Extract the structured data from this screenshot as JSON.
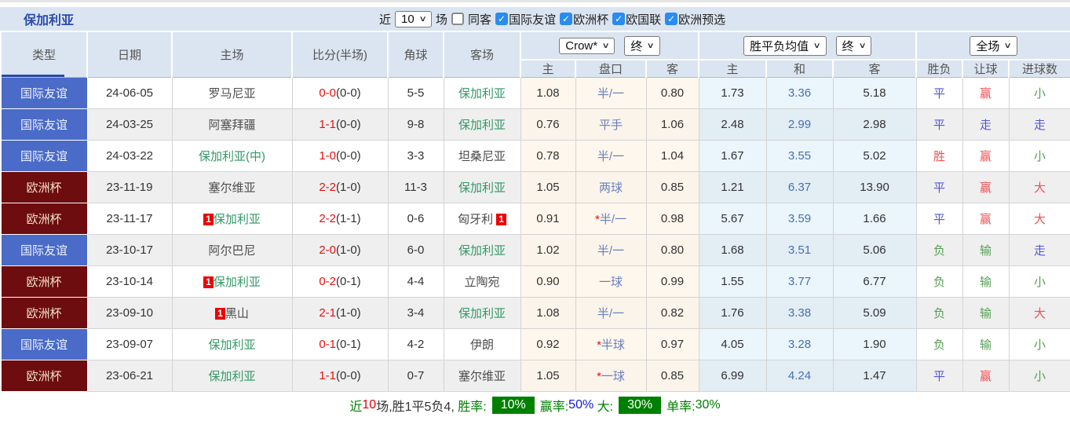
{
  "topbar": {
    "title": "保加利亚",
    "near_label": "近",
    "count_select": "10",
    "count_suffix": "场",
    "same_away": {
      "label": "同客",
      "state": "unchecked"
    },
    "filters": [
      {
        "label": "国际友谊",
        "state": "checked"
      },
      {
        "label": "欧洲杯",
        "state": "checked"
      },
      {
        "label": "欧国联",
        "state": "checked"
      },
      {
        "label": "欧洲预选",
        "state": "checked"
      }
    ]
  },
  "header": {
    "type": "类型",
    "date": "日期",
    "home": "主场",
    "score": "比分(半场)",
    "corner": "角球",
    "away": "客场",
    "odds_select": "Crow*",
    "odds_state_select": "终",
    "odds_sub": {
      "home": "主",
      "handicap": "盘口",
      "away": "客"
    },
    "wdl_select": "胜平负均值",
    "wdl_state_select": "终",
    "wdl_sub": {
      "home": "主",
      "draw": "和",
      "away": "客"
    },
    "result_select": "全场",
    "result_sub": {
      "wdl": "胜负",
      "handicap": "让球",
      "goals": "进球数"
    }
  },
  "rows": [
    {
      "type": "国际友谊",
      "type_color": "blue",
      "date": "24-06-05",
      "home_mark": "",
      "home": "罗马尼亚",
      "home_color": "gray",
      "score_ft": "0-0",
      "score_ht": "(0-0)",
      "corner": "5-5",
      "away": "保加利亚",
      "away_mark": "",
      "away_color": "green",
      "o_home": "1.08",
      "star": "",
      "handicap": "半/一",
      "o_away": "0.80",
      "avg_home": "1.73",
      "avg_draw": "3.36",
      "avg_away": "5.18",
      "res_wdl": "平",
      "res_wdl_color": "blue",
      "res_let": "赢",
      "res_let_color": "red",
      "res_goal": "小",
      "res_goal_color": "green"
    },
    {
      "type": "国际友谊",
      "type_color": "blue",
      "date": "24-03-25",
      "home_mark": "",
      "home": "阿塞拜疆",
      "home_color": "gray",
      "score_ft": "1-1",
      "score_ht": "(0-0)",
      "corner": "9-8",
      "away": "保加利亚",
      "away_mark": "",
      "away_color": "green",
      "o_home": "0.76",
      "star": "",
      "handicap": "平手",
      "o_away": "1.06",
      "avg_home": "2.48",
      "avg_draw": "2.99",
      "avg_away": "2.98",
      "res_wdl": "平",
      "res_wdl_color": "blue",
      "res_let": "走",
      "res_let_color": "blue",
      "res_goal": "走",
      "res_goal_color": "blue"
    },
    {
      "type": "国际友谊",
      "type_color": "blue",
      "date": "24-03-22",
      "home_mark": "",
      "home": "保加利亚(中)",
      "home_color": "green",
      "score_ft": "1-0",
      "score_ht": "(0-0)",
      "corner": "3-3",
      "away": "坦桑尼亚",
      "away_mark": "",
      "away_color": "gray",
      "o_home": "0.78",
      "star": "",
      "handicap": "半/一",
      "o_away": "1.04",
      "avg_home": "1.67",
      "avg_draw": "3.55",
      "avg_away": "5.02",
      "res_wdl": "胜",
      "res_wdl_color": "red",
      "res_let": "赢",
      "res_let_color": "red",
      "res_goal": "小",
      "res_goal_color": "green"
    },
    {
      "type": "欧洲杯",
      "type_color": "red",
      "date": "23-11-19",
      "home_mark": "",
      "home": "塞尔维亚",
      "home_color": "gray",
      "score_ft": "2-2",
      "score_ht": "(1-0)",
      "corner": "11-3",
      "away": "保加利亚",
      "away_mark": "",
      "away_color": "green",
      "o_home": "1.05",
      "star": "",
      "handicap": "两球",
      "o_away": "0.85",
      "avg_home": "1.21",
      "avg_draw": "6.37",
      "avg_away": "13.90",
      "res_wdl": "平",
      "res_wdl_color": "blue",
      "res_let": "赢",
      "res_let_color": "red",
      "res_goal": "大",
      "res_goal_color": "red"
    },
    {
      "type": "欧洲杯",
      "type_color": "red",
      "date": "23-11-17",
      "home_mark": "1",
      "home": "保加利亚",
      "home_color": "green",
      "score_ft": "2-2",
      "score_ht": "(1-1)",
      "corner": "0-6",
      "away": "匈牙利",
      "away_mark": "1",
      "away_color": "gray",
      "o_home": "0.91",
      "star": "*",
      "handicap": "半/一",
      "o_away": "0.98",
      "avg_home": "5.67",
      "avg_draw": "3.59",
      "avg_away": "1.66",
      "res_wdl": "平",
      "res_wdl_color": "blue",
      "res_let": "赢",
      "res_let_color": "red",
      "res_goal": "大",
      "res_goal_color": "red"
    },
    {
      "type": "国际友谊",
      "type_color": "blue",
      "date": "23-10-17",
      "home_mark": "",
      "home": "阿尔巴尼",
      "home_color": "gray",
      "score_ft": "2-0",
      "score_ht": "(1-0)",
      "corner": "6-0",
      "away": "保加利亚",
      "away_mark": "",
      "away_color": "green",
      "o_home": "1.02",
      "star": "",
      "handicap": "半/一",
      "o_away": "0.80",
      "avg_home": "1.68",
      "avg_draw": "3.51",
      "avg_away": "5.06",
      "res_wdl": "负",
      "res_wdl_color": "green",
      "res_let": "输",
      "res_let_color": "green",
      "res_goal": "走",
      "res_goal_color": "blue"
    },
    {
      "type": "欧洲杯",
      "type_color": "red",
      "date": "23-10-14",
      "home_mark": "1",
      "home": "保加利亚",
      "home_color": "green",
      "score_ft": "0-2",
      "score_ht": "(0-1)",
      "corner": "4-4",
      "away": "立陶宛",
      "away_mark": "",
      "away_color": "gray",
      "o_home": "0.90",
      "star": "",
      "handicap": "一球",
      "o_away": "0.99",
      "avg_home": "1.55",
      "avg_draw": "3.77",
      "avg_away": "6.77",
      "res_wdl": "负",
      "res_wdl_color": "green",
      "res_let": "输",
      "res_let_color": "green",
      "res_goal": "小",
      "res_goal_color": "green"
    },
    {
      "type": "欧洲杯",
      "type_color": "red",
      "date": "23-09-10",
      "home_mark": "1",
      "home": "黑山",
      "home_color": "gray",
      "score_ft": "2-1",
      "score_ht": "(1-0)",
      "corner": "3-4",
      "away": "保加利亚",
      "away_mark": "",
      "away_color": "green",
      "o_home": "1.08",
      "star": "",
      "handicap": "半/一",
      "o_away": "0.82",
      "avg_home": "1.76",
      "avg_draw": "3.38",
      "avg_away": "5.09",
      "res_wdl": "负",
      "res_wdl_color": "green",
      "res_let": "输",
      "res_let_color": "green",
      "res_goal": "大",
      "res_goal_color": "red"
    },
    {
      "type": "国际友谊",
      "type_color": "blue",
      "date": "23-09-07",
      "home_mark": "",
      "home": "保加利亚",
      "home_color": "green",
      "score_ft": "0-1",
      "score_ht": "(0-1)",
      "corner": "4-2",
      "away": "伊朗",
      "away_mark": "",
      "away_color": "gray",
      "o_home": "0.92",
      "star": "*",
      "handicap": "半球",
      "o_away": "0.97",
      "avg_home": "4.05",
      "avg_draw": "3.28",
      "avg_away": "1.90",
      "res_wdl": "负",
      "res_wdl_color": "green",
      "res_let": "输",
      "res_let_color": "green",
      "res_goal": "小",
      "res_goal_color": "green"
    },
    {
      "type": "欧洲杯",
      "type_color": "red",
      "date": "23-06-21",
      "home_mark": "",
      "home": "保加利亚",
      "home_color": "green",
      "score_ft": "1-1",
      "score_ht": "(0-0)",
      "corner": "0-7",
      "away": "塞尔维亚",
      "away_mark": "",
      "away_color": "gray",
      "o_home": "1.05",
      "star": "*",
      "handicap": "一球",
      "o_away": "0.85",
      "avg_home": "6.99",
      "avg_draw": "4.24",
      "avg_away": "1.47",
      "res_wdl": "平",
      "res_wdl_color": "blue",
      "res_let": "赢",
      "res_let_color": "red",
      "res_goal": "小",
      "res_goal_color": "green"
    }
  ],
  "summary": {
    "near": "近",
    "count": "10",
    "tail": "场,胜1平5负4, ",
    "win_label": "胜率:",
    "win_badge": "10%",
    "odds_label": "赢率:",
    "odds_value": "50%",
    "big_label": " 大:",
    "big_badge": "30%",
    "single_label": "单率:",
    "single_value": "30%"
  },
  "colors": {
    "accent_blue_badge": "#4a6bc8",
    "accent_red_badge": "#6d0d10",
    "header_bg": "#dbe5f1",
    "green_team": "#339966",
    "summary_green": "#008000"
  }
}
